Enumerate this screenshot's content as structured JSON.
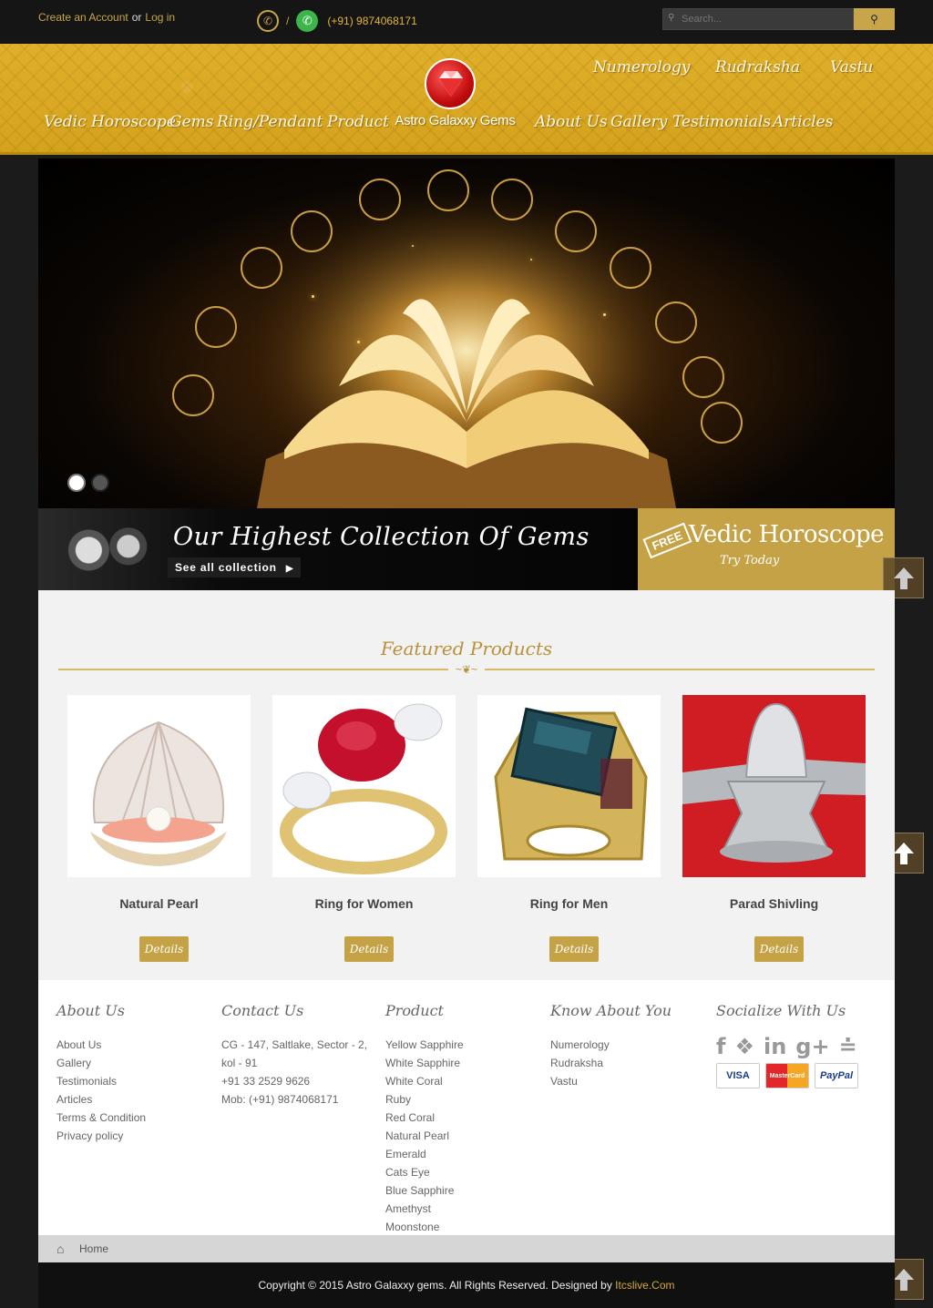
{
  "topbar": {
    "create_account": "Create an Account",
    "or": "or",
    "login": "Log in",
    "slash": "/",
    "phone": "(+91) 9874068171",
    "search_placeholder": "Search..."
  },
  "nav": {
    "top_row": [
      "Numerology",
      "Rudraksha",
      "Vastu"
    ],
    "left_row": [
      "Vedic Horoscope",
      "Gems",
      "Ring/Pendant",
      "Product"
    ],
    "right_row": [
      "About Us",
      "Gallery",
      "Testimonials",
      "Articles"
    ],
    "brand": "Astro Galaxxy Gems"
  },
  "promo": {
    "title": "Our Highest Collection Of Gems",
    "link": "See all collection",
    "tag": "FREE",
    "right_title": "Vedic Horoscope",
    "right_sub": "Try Today"
  },
  "featured": {
    "heading": "Featured Products",
    "details_label": "Details",
    "products": [
      "Natural Pearl",
      "Ring for Women",
      "Ring for Men",
      "Parad Shivling"
    ]
  },
  "footer": {
    "about": {
      "title": "About Us",
      "links": [
        "About Us",
        "Gallery",
        "Testimonials",
        "Articles",
        "Terms & Condition",
        "Privacy policy"
      ]
    },
    "contact": {
      "title": "Contact Us",
      "lines": [
        "CG - 147, Saltlake, Sector - 2,",
        "kol - 91",
        "+91 33 2529 9626",
        "Mob: (+91) 9874068171"
      ]
    },
    "product": {
      "title": "Product",
      "links": [
        "Yellow Sapphire",
        "White Sapphire",
        "White Coral",
        "Ruby",
        "Red Coral",
        "Natural Pearl",
        "Emerald",
        "Cats Eye",
        "Blue Sapphire",
        "Amethyst",
        "Moonstone"
      ]
    },
    "know": {
      "title": "Know About You",
      "links": [
        "Numerology",
        "Rudraksha",
        "Vastu"
      ]
    },
    "social": {
      "title": "Socialize With Us",
      "payments": [
        "VISA",
        "MasterCard",
        "PayPal"
      ]
    }
  },
  "breadcrumb": {
    "home": "Home"
  },
  "copyright": {
    "text": "Copyright © 2015 Astro Galaxxy gems. All Rights Reserved. Designed by ",
    "link": "Itcslive.Com"
  },
  "colors": {
    "gold": "#c4a245",
    "nav_gold": "#d9a823",
    "dark": "#151515"
  }
}
